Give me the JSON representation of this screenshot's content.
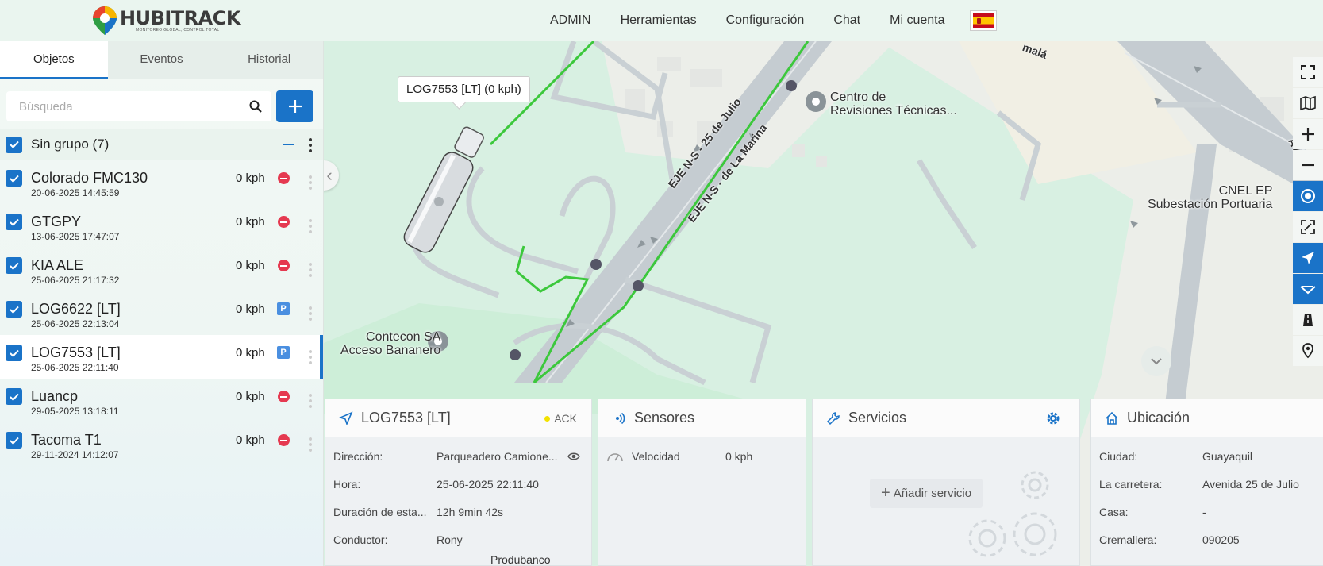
{
  "brand": {
    "name": "HUBITRACK",
    "tagline": "MONITOREO GLOBAL, CONTROL TOTAL"
  },
  "nav": [
    "ADMIN",
    "Herramientas",
    "Configuración",
    "Chat",
    "Mi cuenta"
  ],
  "language_flag": "es",
  "sidebar": {
    "tabs": [
      "Objetos",
      "Eventos",
      "Historial"
    ],
    "active_tab": "Objetos",
    "search_placeholder": "Búsqueda",
    "group": {
      "label": "Sin grupo (7)"
    },
    "objects": [
      {
        "name": "Colorado FMC130",
        "time": "20-06-2025 14:45:59",
        "speed": "0 kph",
        "status": "stopped"
      },
      {
        "name": "GTGPY",
        "time": "13-06-2025 17:47:07",
        "speed": "0 kph",
        "status": "stopped"
      },
      {
        "name": "KIA ALE",
        "time": "25-06-2025 21:17:32",
        "speed": "0 kph",
        "status": "stopped"
      },
      {
        "name": "LOG6622 [LT]",
        "time": "25-06-2025 22:13:04",
        "speed": "0 kph",
        "status": "parked"
      },
      {
        "name": "LOG7553 [LT]",
        "time": "25-06-2025 22:11:40",
        "speed": "0 kph",
        "status": "parked",
        "selected": true
      },
      {
        "name": "Luancp",
        "time": "29-05-2025 13:18:11",
        "speed": "0 kph",
        "status": "stopped"
      },
      {
        "name": "Tacoma T1",
        "time": "29-11-2024 14:12:07",
        "speed": "0 kph",
        "status": "stopped"
      }
    ]
  },
  "map": {
    "vehicle_tooltip": "LOG7553 [LT] (0 kph)",
    "labels": {
      "poi_revisiones_1": "Centro de",
      "poi_revisiones_2": "Revisiones Técnicas...",
      "poi_contecon_1": "Contecon SA",
      "poi_contecon_2": "Acceso Bananero",
      "poi_cnel_1": "CNEL EP",
      "poi_cnel_2": "Subestación Portuaria",
      "road_1": "EJE N-S - 25 de Julio",
      "road_2": "EJE N-S - de La Marina",
      "road_3": "malá",
      "road_4": "Av. M",
      "poi_bottom": "Produbanco"
    },
    "route_color": "#3cc83c"
  },
  "panels": {
    "object": {
      "title": "LOG7553 [LT]",
      "ack": "ACK",
      "rows": [
        {
          "k": "Dirección:",
          "v": "Parqueadero Camione..."
        },
        {
          "k": "Hora:",
          "v": "25-06-2025 22:11:40"
        },
        {
          "k": "Duración de esta...",
          "v": "12h 9min 42s"
        },
        {
          "k": "Conductor:",
          "v": "Rony"
        }
      ]
    },
    "sensors": {
      "title": "Sensores",
      "rows": [
        {
          "k": "Velocidad",
          "v": "0 kph"
        }
      ]
    },
    "services": {
      "title": "Servicios",
      "add_label": "Añadir servicio"
    },
    "location": {
      "title": "Ubicación",
      "rows": [
        {
          "k": "Ciudad:",
          "v": "Guayaquil"
        },
        {
          "k": "La carretera:",
          "v": "Avenida 25 de Julio"
        },
        {
          "k": "Casa:",
          "v": "-"
        },
        {
          "k": "Cremallera:",
          "v": "090205"
        }
      ]
    }
  },
  "colors": {
    "accent": "#1a73c8",
    "stop": "#e53950",
    "park": "#4a8fe0"
  }
}
